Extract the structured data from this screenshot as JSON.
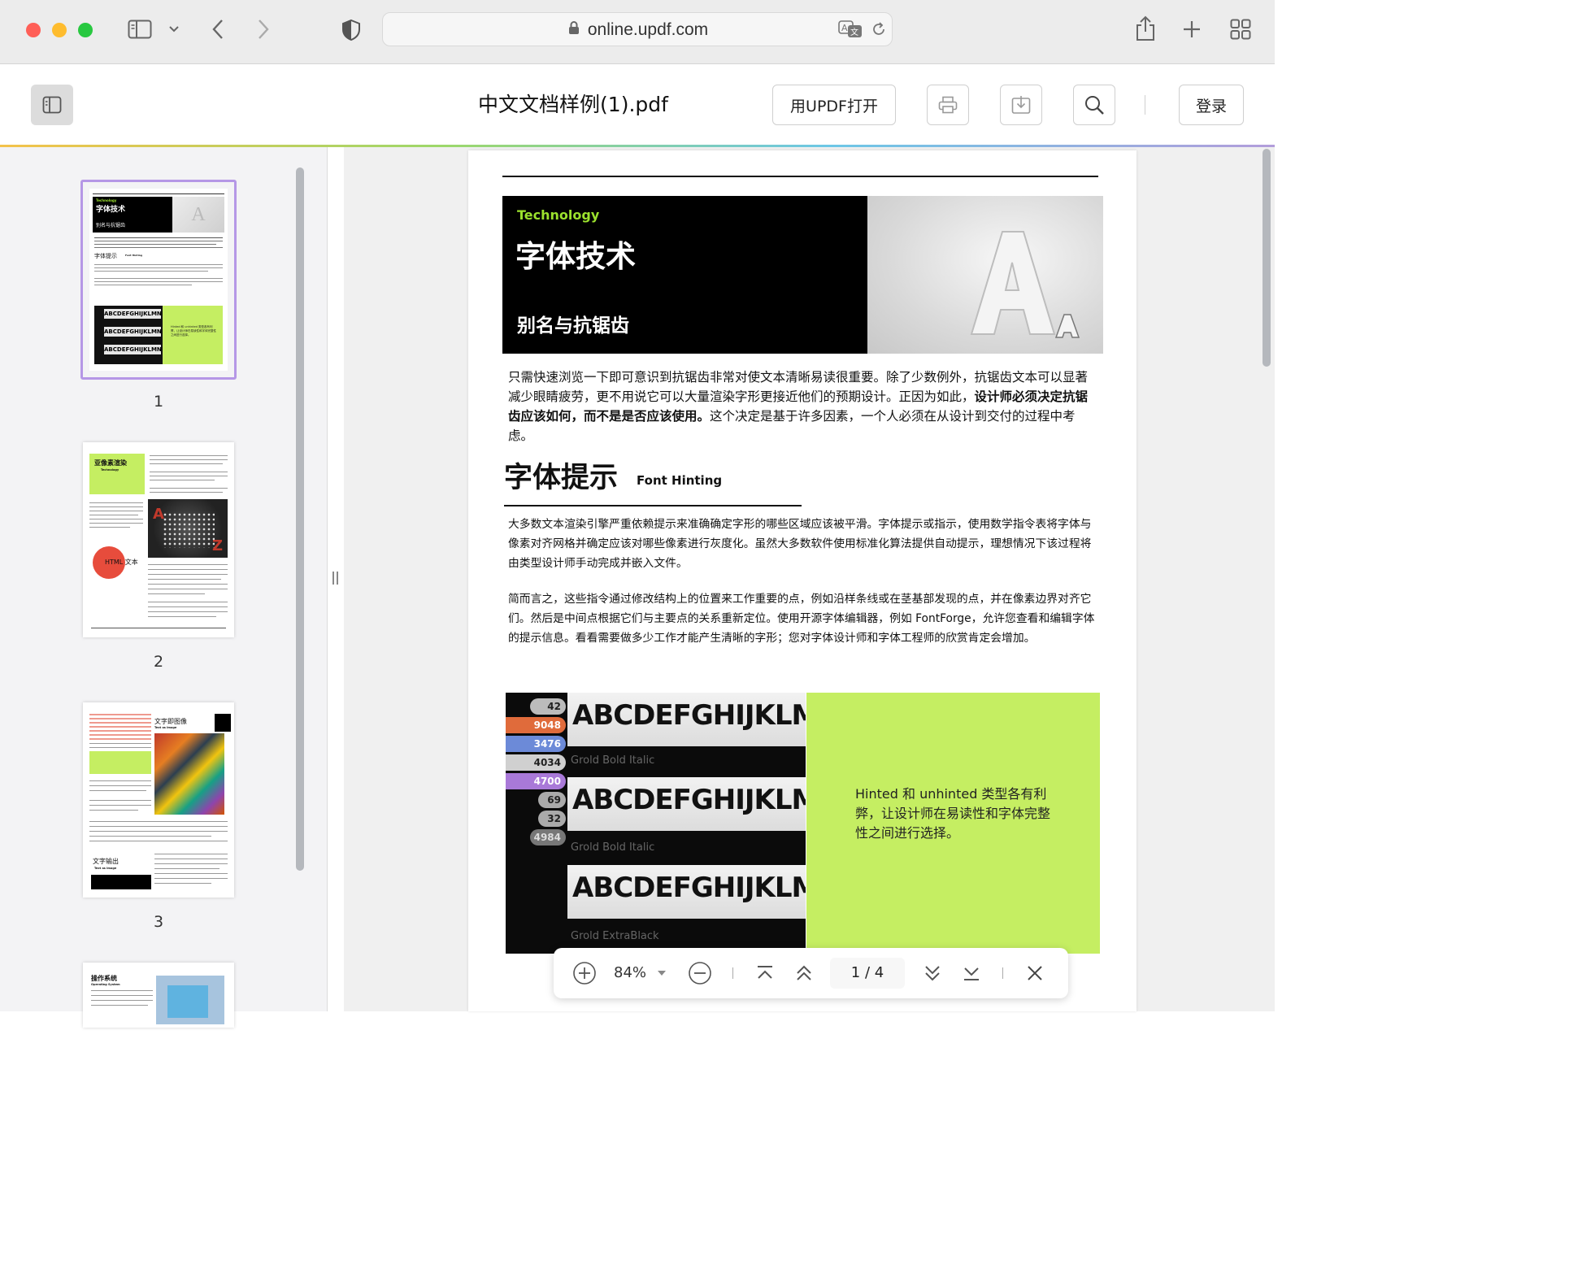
{
  "browser": {
    "url": "online.updf.com"
  },
  "app": {
    "file_title": "中文文档样例(1).pdf",
    "open_button": "用UPDF打开",
    "login_button": "登录"
  },
  "thumbnails": [
    {
      "page": "1"
    },
    {
      "page": "2"
    },
    {
      "page": "3"
    }
  ],
  "thumb_text": {
    "p1_kicker": "Technology",
    "p1_title": "字体技术",
    "p1_sub": "别名与抗锯齿",
    "p1_section": "字体提示",
    "p1_section_en": "Font Hinting",
    "p1_caption": "Hinted 和 unhinted 类型各有利弊，让设计师在易读性和字体完整性之间进行选择。",
    "p2_title": "亚像素渲染",
    "p2_en": "Technology",
    "p2_html": "HTML 文本",
    "p3_title": "文字即图像",
    "p3_en": "Text as Image",
    "p3_section": "文字输出",
    "p3_section_en": "Text Output",
    "p4_title": "操作系统",
    "p4_en": "Operating System"
  },
  "document": {
    "hero_kicker": "Technology",
    "hero_title": "字体技术",
    "hero_subtitle": "别名与抗锯齿",
    "para1_a": "只需快速浏览一下即可意识到抗锯齿非常对使文本清晰易读很重要。除了少数例外，抗锯齿文本可以显著减少眼睛疲劳，更不用说它可以大量渲染字形更接近他们的预期设计。正因为如此，",
    "para1_bold": "设计师必须决定抗锯齿应该如何，而不是是否应该使用。",
    "para1_b": "这个决定是基于许多因素，一个人必须在从设计到交付的过程中考虑。",
    "section_title": "字体提示",
    "section_title_en": "Font Hinting",
    "para2": "大多数文本渲染引擎严重依赖提示来准确确定字形的哪些区域应该被平滑。字体提示或指示，使用数学指令表将字体与像素对齐网格并确定应该对哪些像素进行灰度化。虽然大多数软件使用标准化算法提供自动提示，理想情况下该过程将由类型设计师手动完成并嵌入文件。",
    "para3": "简而言之，这些指令通过修改结构上的位置来工作重要的点，例如沿样条线或在茎基部发现的点，并在像素边界对齐它们。然后是中间点根据它们与主要点的关系重新定位。使用开源字体编辑器，例如 FontForge，允许您查看和编辑字体的提示信息。看看需要做多少工作才能产生清晰的字形；您对字体设计师和字体工程师的欣赏肯定会增加。",
    "image_text": "ABCDEFGHIJKLMNO",
    "image_small": "Grold Bold Italic",
    "image_small2": "Grold ExtraBlack",
    "image_numbers": [
      "42",
      "9048",
      "3476",
      "4034",
      "4700",
      "69",
      "32",
      "4984"
    ],
    "caption": "Hinted 和 unhinted 类型各有利弊，让设计师在易读性和字体完整性之间进行选择。"
  },
  "bottom_bar": {
    "zoom": "84%",
    "page_current": "1",
    "page_sep": "/",
    "page_total": "4"
  },
  "colors": {
    "accent_green": "#c5ee62",
    "thumb_border": "#b597e6",
    "tag_green": "#9be12d"
  }
}
